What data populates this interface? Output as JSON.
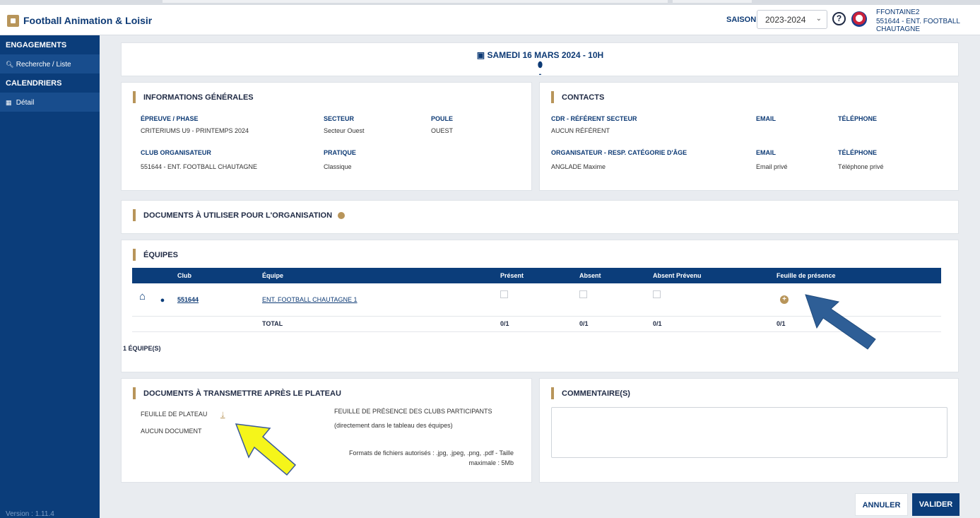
{
  "header": {
    "app_title": "Football Animation & Loisir",
    "saison_label": "SAISON",
    "saison_value": "2023-2024",
    "help_icon": "help-circle-icon",
    "user_name": "FFONTAINE2",
    "user_club": "551644 - ENT. FOOTBALL CHAUTAGNE"
  },
  "sidebar": {
    "engagements": "ENGAGEMENTS",
    "recherche": "Recherche / Liste",
    "calendriers": "CALENDRIERS",
    "detail": "Détail",
    "version": "Version : 1.11.4"
  },
  "event": {
    "date": "SAMEDI 16 MARS 2024 - 10H",
    "location": "-"
  },
  "infos": {
    "title": "INFORMATIONS GÉNÉRALES",
    "epreuve_label": "ÉPREUVE / PHASE",
    "epreuve_value": "CRITERIUMS U9 - PRINTEMPS 2024",
    "secteur_label": "SECTEUR",
    "secteur_value": "Secteur Ouest",
    "poule_label": "POULE",
    "poule_value": "OUEST",
    "club_label": "CLUB ORGANISATEUR",
    "club_value": "551644 - ENT. FOOTBALL CHAUTAGNE",
    "pratique_label": "PRATIQUE",
    "pratique_value": "Classique"
  },
  "contacts": {
    "title": "CONTACTS",
    "cdr_label": "CDR - RÉFÉRENT SECTEUR",
    "cdr_value": "AUCUN RÉFÉRENT",
    "email_label": "EMAIL",
    "tel_label": "TÉLÉPHONE",
    "org_label": "ORGANISATEUR - RESP. CATÉGORIE D'ÂGE",
    "org_value": "ANGLADE Maxime",
    "org_email": "Email privé",
    "org_tel": "Téléphone privé"
  },
  "documents": {
    "title": "DOCUMENTS À UTILISER POUR L'ORGANISATION"
  },
  "equipes": {
    "title": "ÉQUIPES",
    "headers": [
      "Club",
      "Équipe",
      "Présent",
      "Absent",
      "Absent Prévenu",
      "Feuille de présence"
    ],
    "row": {
      "club": "551644",
      "equipe": "ENT. FOOTBALL CHAUTAGNE 1"
    },
    "total": {
      "label": "TOTAL",
      "present": "0/1",
      "absent": "0/1",
      "prevenu": "0/1",
      "feuille": "0/1"
    },
    "count": "1 ÉQUIPE(S)"
  },
  "transmettre": {
    "title": "DOCUMENTS À TRANSMETTRE APRÈS LE PLATEAU",
    "feuille_plateau": "FEUILLE DE PLATEAU",
    "aucun_doc": "AUCUN DOCUMENT",
    "feuille_presence": "FEUILLE DE PRÉSENCE DES CLUBS PARTICIPANTS",
    "feuille_presence_sub": "(directement dans le tableau des équipes)",
    "formats_1": "Formats de fichiers autorisés : .jpg, .jpeg, .png, .pdf - Taille",
    "formats_2": "maximale : 5Mb"
  },
  "commentaires": {
    "title": "COMMENTAIRE(S)"
  },
  "actions": {
    "cancel": "ANNULER",
    "validate": "VALIDER"
  },
  "colors": {
    "navy": "#0b3d7a",
    "gold": "#b8955a",
    "arrow_blue": "#2e5e96",
    "arrow_yellow": "#f5f51a"
  }
}
